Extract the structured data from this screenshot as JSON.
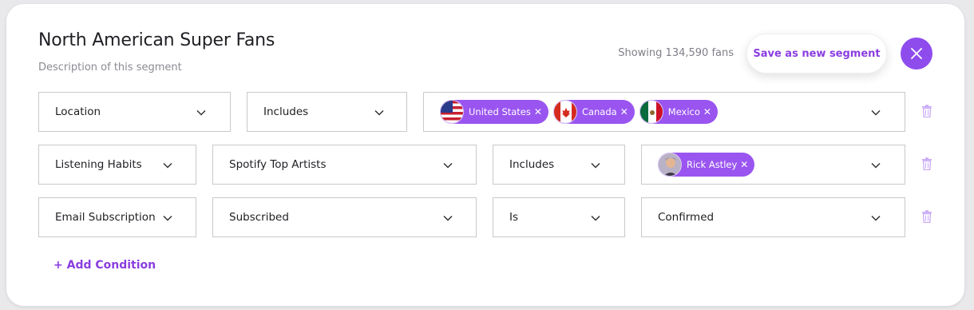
{
  "segment": {
    "title": "North American Super Fans",
    "description": "Description of this segment",
    "showing": "Showing 134,590 fans"
  },
  "actions": {
    "save_label": "Save as new segment",
    "close_icon": "close-icon"
  },
  "rows": [
    {
      "category": "Location",
      "operator": "Includes",
      "chips": [
        {
          "label": "United States",
          "icon": "us-flag-icon"
        },
        {
          "label": "Canada",
          "icon": "canada-flag-icon"
        },
        {
          "label": "Mexico",
          "icon": "mexico-flag-icon"
        }
      ]
    },
    {
      "category": "Listening Habits",
      "sub": "Spotify Top Artists",
      "operator": "Includes",
      "chips": [
        {
          "label": "Rick Astley",
          "icon": "artist-avatar"
        }
      ]
    },
    {
      "category": "Email Subscription",
      "sub": "Subscribed",
      "operator": "Is",
      "value": "Confirmed"
    }
  ],
  "add_condition_label": "+ Add Condition",
  "colors": {
    "accent": "#8f4ced",
    "chip": "#9a55f0",
    "trash": "#c7a7f5"
  }
}
